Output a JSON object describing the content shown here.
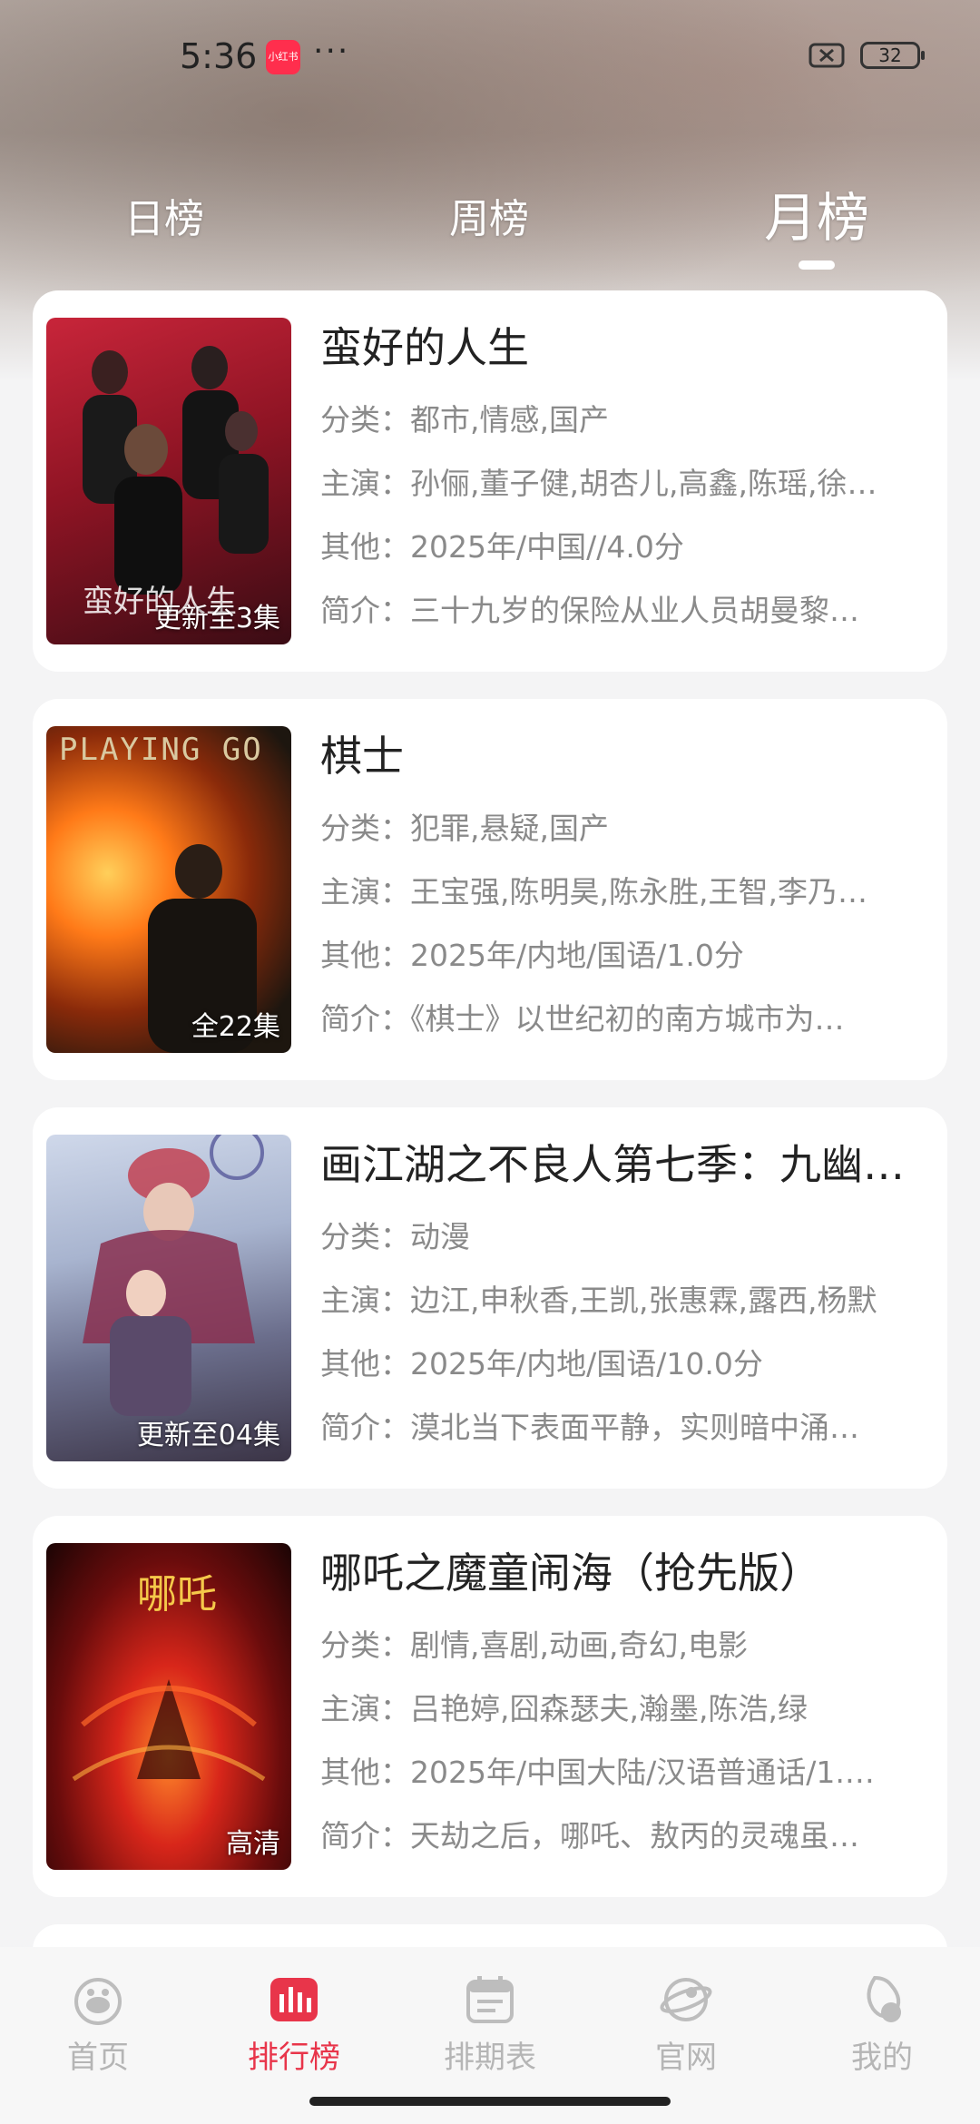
{
  "status_bar": {
    "time": "5:36",
    "app_badge": "小红书",
    "more": "···",
    "battery": "32"
  },
  "tabs": [
    {
      "label": "日榜"
    },
    {
      "label": "周榜"
    },
    {
      "label": "月榜",
      "active": true
    }
  ],
  "items": [
    {
      "title": "蛮好的人生",
      "badge": "更新至3集",
      "poster_text": "蛮好的人生",
      "category": "分类：都市,情感,国产",
      "cast": "主演：孙俪,董子健,胡杏儿,高鑫,陈瑶,徐…",
      "other": "其他：2025年/中国//4.0分",
      "intro": "简介：三十九岁的保险从业人员胡曼黎…"
    },
    {
      "title": "棋士",
      "badge": "全22集",
      "poster_text": "PLAYING GO",
      "category": "分类：犯罪,悬疑,国产",
      "cast": "主演：王宝强,陈明昊,陈永胜,王智,李乃…",
      "other": "其他：2025年/内地/国语/1.0分",
      "intro": "简介：《棋士》以世纪初的南方城市为…"
    },
    {
      "title": "画江湖之不良人第七季：九幽…",
      "badge": "更新至04集",
      "poster_text": "",
      "category": "分类：动漫",
      "cast": "主演：边江,申秋香,王凯,张惠霖,露西,杨默",
      "other": "其他：2025年/内地/国语/10.0分",
      "intro": "简介：漠北当下表面平静，实则暗中涌…"
    },
    {
      "title": "哪吒之魔童闹海（抢先版）",
      "badge": "高清",
      "poster_text": "哪吒",
      "category": "分类：剧情,喜剧,动画,奇幻,电影",
      "cast": "主演：吕艳婷,囧森瑟夫,瀚墨,陈浩,绿",
      "other": "其他：2025年/中国大陆/汉语普通话/1.…",
      "intro": "简介：天劫之后，哪吒、敖丙的灵魂虽…"
    }
  ],
  "bottom_nav": [
    {
      "label": "首页",
      "icon": "home-icon"
    },
    {
      "label": "排行榜",
      "icon": "ranking-icon",
      "active": true
    },
    {
      "label": "排期表",
      "icon": "calendar-icon"
    },
    {
      "label": "官网",
      "icon": "globe-icon"
    },
    {
      "label": "我的",
      "icon": "profile-icon"
    }
  ],
  "colors": {
    "accent": "#e8354a",
    "inactive_nav": "#b5b5b5",
    "meta_text": "#8a8a8a"
  }
}
